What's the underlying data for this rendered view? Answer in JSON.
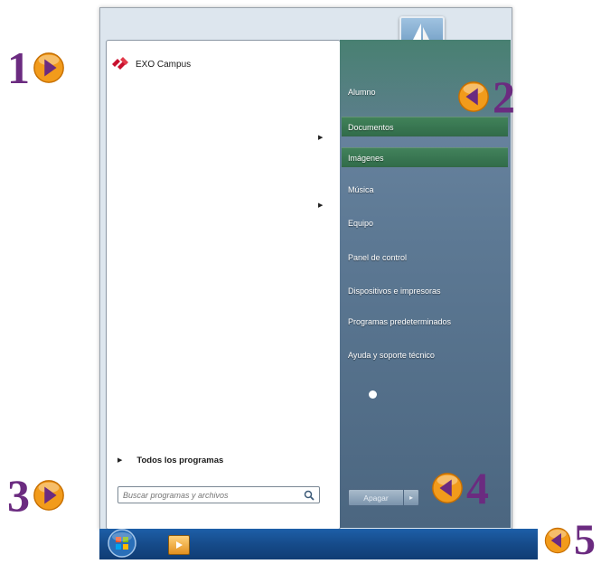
{
  "pinned_program": {
    "label": "EXO Campus",
    "icon": "exo-campus-logo"
  },
  "all_programs": {
    "label": "Todos los programas"
  },
  "search": {
    "placeholder": "Buscar programas y archivos",
    "icon": "search-icon"
  },
  "right_items": [
    {
      "label": "Alumno"
    },
    {
      "label": "Documentos"
    },
    {
      "label": "Imágenes"
    },
    {
      "label": "Música"
    },
    {
      "label": "Equipo"
    },
    {
      "label": "Panel de control"
    },
    {
      "label": "Dispositivos e impresoras"
    },
    {
      "label": "Programas predeterminados"
    },
    {
      "label": "Ayuda y soporte técnico"
    }
  ],
  "shutdown": {
    "label": "Apagar",
    "arrow": "▸"
  },
  "callouts": [
    {
      "number": "1"
    },
    {
      "number": "2"
    },
    {
      "number": "3"
    },
    {
      "number": "4"
    },
    {
      "number": "5"
    }
  ],
  "colors": {
    "callout_text": "#6b2b80",
    "badge_fill": "#f29b1b",
    "badge_arrow": "#6b2b80",
    "taskbar": "#164b8a",
    "right_pane": "#5d7994",
    "highlight": "#3c8250"
  }
}
